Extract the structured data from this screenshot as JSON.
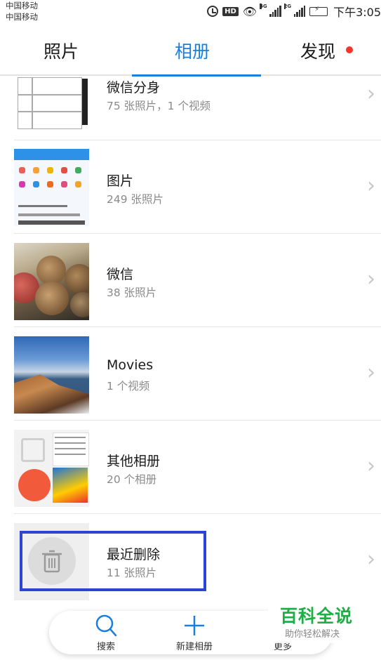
{
  "status_bar": {
    "carrier_1": "中国移动",
    "carrier_2": "中国移动",
    "hd_label": "HD",
    "sim1_network": "4G",
    "sim2_network": "2G",
    "time": "下午3:05",
    "icons": [
      "alarm-icon",
      "hd-icon",
      "eye-icon",
      "signal-icon",
      "battery-charging-icon"
    ]
  },
  "tabs": [
    {
      "label": "照片",
      "active": false
    },
    {
      "label": "相册",
      "active": true
    },
    {
      "label": "发现",
      "active": false,
      "badge": true
    }
  ],
  "albums": [
    {
      "title": "微信分身",
      "subtitle": "75 张照片，1 个视频"
    },
    {
      "title": "图片",
      "subtitle": "249 张照片"
    },
    {
      "title": "微信",
      "subtitle": "38 张照片"
    },
    {
      "title": "Movies",
      "subtitle": "1 个视频"
    },
    {
      "title": "其他相册",
      "subtitle": "20 个相册"
    },
    {
      "title": "最近删除",
      "subtitle": "11 张照片"
    }
  ],
  "bottom_bar": {
    "search_label": "搜索",
    "new_album_label": "新建相册",
    "more_label": "更多"
  },
  "watermark": {
    "title": "百科全说",
    "subtitle": "助你轻松解决"
  },
  "colors": {
    "accent": "#1a7fdc",
    "badge": "#f2362b",
    "highlight": "#2b44d6",
    "watermark_green": "#1fae46"
  }
}
